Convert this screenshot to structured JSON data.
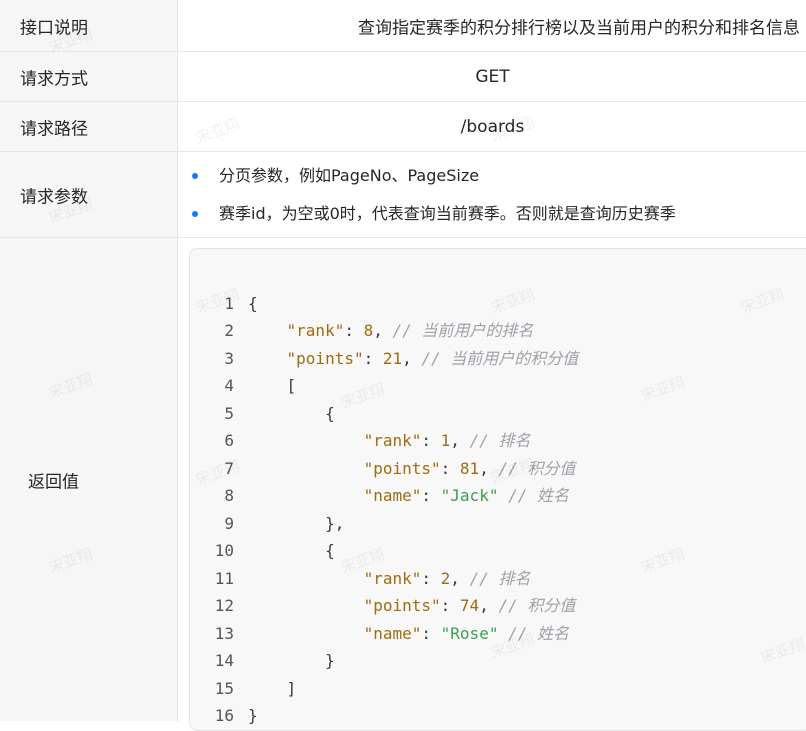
{
  "rows": {
    "description": {
      "label": "接口说明",
      "value": "查询指定赛季的积分排行榜以及当前用户的积分和排名信息"
    },
    "method": {
      "label": "请求方式",
      "value": "GET"
    },
    "path": {
      "label": "请求路径",
      "value": "/boards"
    },
    "params": {
      "label": "请求参数",
      "items": [
        "分页参数，例如PageNo、PageSize",
        "赛季id，为空或0时，代表查询当前赛季。否则就是查询历史赛季"
      ]
    },
    "response": {
      "label": "返回值",
      "code": {
        "line_numbers": [
          "1",
          "2",
          "3",
          "4",
          "5",
          "6",
          "7",
          "8",
          "9",
          "10",
          "11",
          "12",
          "13",
          "14",
          "15",
          "16"
        ],
        "brace_open": "{",
        "brace_close": "}",
        "bracket_open": "[",
        "bracket_close": "]",
        "obj_close_comma": "},",
        "key_rank": "\"rank\"",
        "key_points": "\"points\"",
        "key_name": "\"name\"",
        "colon": ": ",
        "comma": ", ",
        "rank_value": "8",
        "rank_comment": "// 当前用户的排名",
        "points_value": "21",
        "points_comment": "// 当前用户的积分值",
        "item1": {
          "rank": "1",
          "points": "81",
          "name": "\"Jack\""
        },
        "item2": {
          "rank": "2",
          "points": "74",
          "name": "\"Rose\""
        },
        "comment_rank": "// 排名",
        "comment_points": "// 积分值",
        "comment_name": "// 姓名"
      }
    }
  },
  "watermark_text": "宋亚翔",
  "colors": {
    "bullet": "#1677ff",
    "key": "#a06b10",
    "string": "#3e9f4a",
    "comment": "#a0a1a7"
  }
}
